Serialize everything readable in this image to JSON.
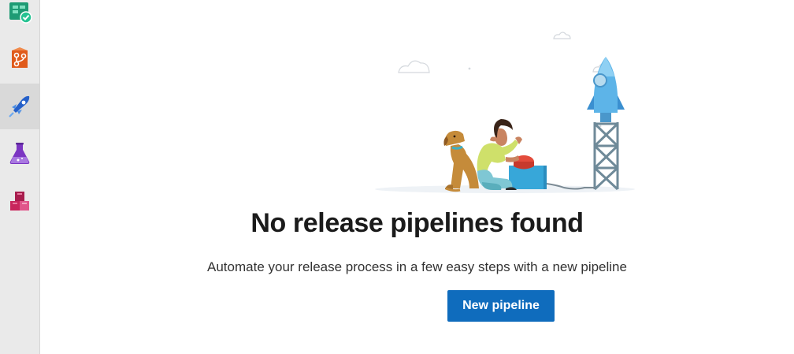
{
  "sidebar": {
    "items": [
      {
        "id": "boards",
        "icon": "boards-icon",
        "color": "#009ccc"
      },
      {
        "id": "repos",
        "icon": "repos-icon",
        "color": "#e05b1c"
      },
      {
        "id": "pipelines",
        "icon": "pipelines-icon",
        "color": "#2d7ed8",
        "selected": true
      },
      {
        "id": "test-plans",
        "icon": "test-plans-icon",
        "color": "#8a3fc8"
      },
      {
        "id": "artifacts",
        "icon": "artifacts-icon",
        "color": "#c8265c"
      }
    ]
  },
  "empty_state": {
    "illustration": "rocket-launch-illustration",
    "title": "No release pipelines found",
    "description": "Automate your release process in a few easy steps with a new pipeline",
    "button_label": "New pipeline"
  },
  "colors": {
    "accent": "#0f6cbd",
    "sidebar_bg": "#eaeaea"
  }
}
